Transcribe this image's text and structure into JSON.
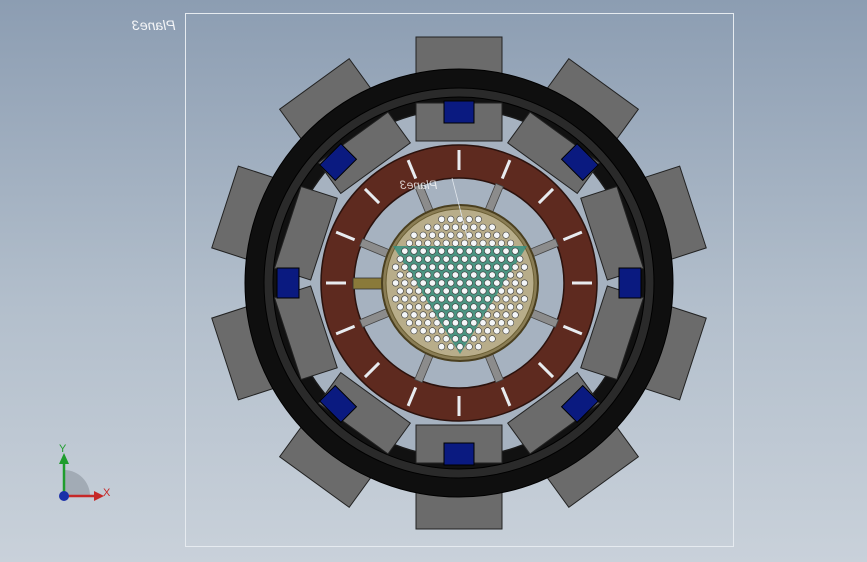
{
  "viewport": {
    "plane_label": "Plane3",
    "inner_plane_label": "Plane3",
    "axes": {
      "x": "X",
      "y": "Y"
    }
  },
  "model": {
    "coil_count": 10,
    "ring_slot_count": 16,
    "spoke_count": 8,
    "colors": {
      "outer_ring": "#141414",
      "coil": "#6b6b6b",
      "connector": "#0a1a80",
      "copper_ring": "#5e2a1f",
      "perforated_disc": "#9a8f6e",
      "triangle_fill": "#2f8f80"
    }
  }
}
